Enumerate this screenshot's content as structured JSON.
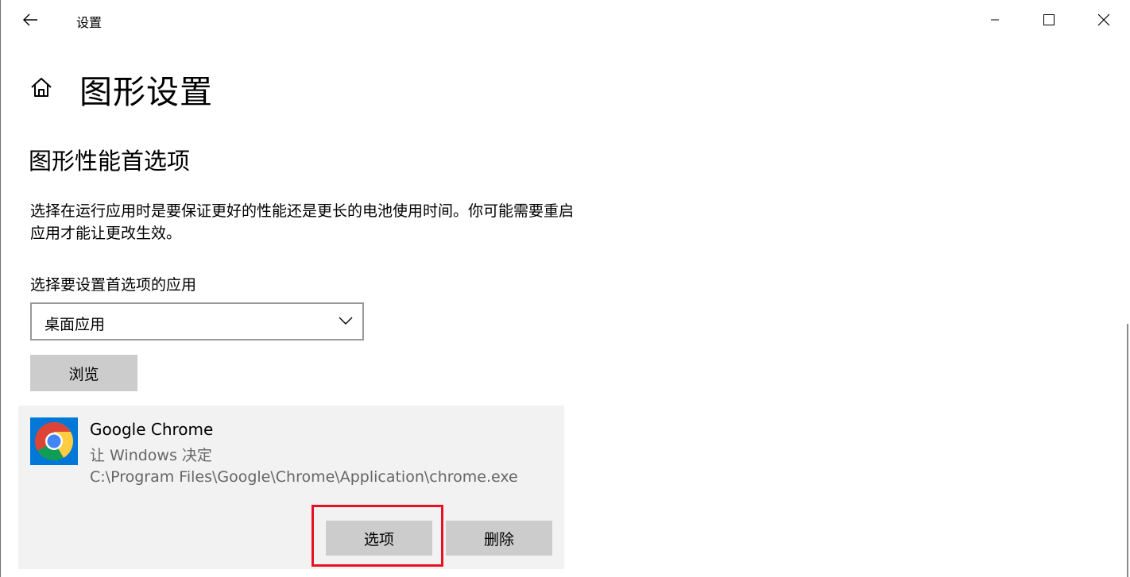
{
  "window": {
    "title": "设置",
    "controls": {
      "minimize_icon": "minimize-icon",
      "maximize_icon": "maximize-icon",
      "close_icon": "close-icon"
    },
    "back_icon": "back-arrow-icon"
  },
  "header": {
    "home_icon": "home-icon",
    "title": "图形设置"
  },
  "section": {
    "title": "图形性能首选项",
    "description": "选择在运行应用时是要保证更好的性能还是更长的电池使用时间。你可能需要重启应用才能让更改生效。",
    "select_label": "选择要设置首选项的应用",
    "dropdown_value": "桌面应用",
    "browse_label": "浏览"
  },
  "app_card": {
    "icon": "chrome-icon",
    "name": "Google Chrome",
    "preference": "让 Windows 决定",
    "path": "C:\\Program Files\\Google\\Chrome\\Application\\chrome.exe",
    "options_label": "选项",
    "delete_label": "删除"
  },
  "colors": {
    "accent": "#0078d7",
    "highlight": "#e81123",
    "button_bg": "#cccccc",
    "card_bg": "#f2f2f2"
  }
}
